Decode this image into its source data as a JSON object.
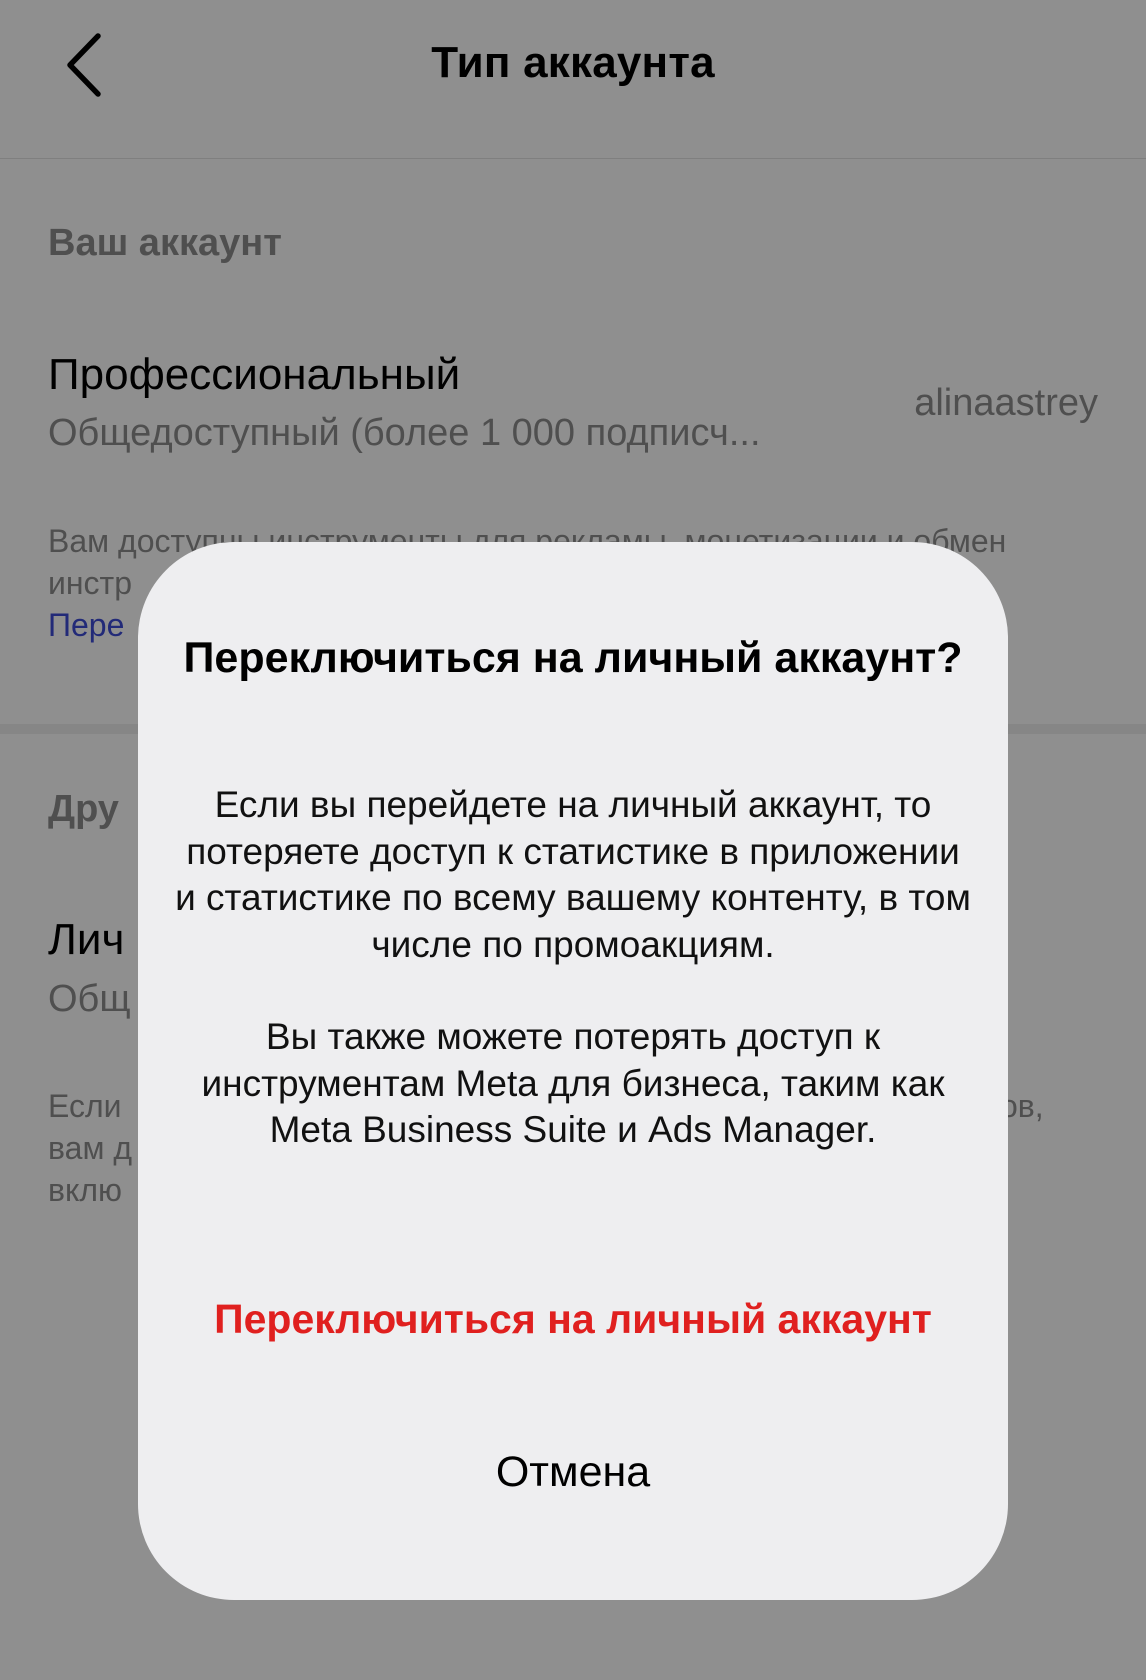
{
  "header": {
    "title": "Тип аккаунта"
  },
  "your_account": {
    "section_title": "Ваш аккаунт",
    "type_title": "Профессиональный",
    "type_subtitle": "Общедоступный (более 1 000 подписч...",
    "username": "alinaastrey",
    "description": "Вам доступны инструменты для рекламы, монетизации и обмен инстр",
    "link_text": "Пере"
  },
  "other_accounts": {
    "section_title": "Дру",
    "type_title": "Лич",
    "type_subtitle": "Общ",
    "description_start": "Если",
    "description_end": "ов,",
    "description_line2": "вам д",
    "description_line3": "вклю"
  },
  "dialog": {
    "title": "Переключиться на личный аккаунт?",
    "body_paragraph_1": "Если вы перейдете на личный аккаунт, то потеряете доступ к статистике в приложении и статистике по всему вашему контенту, в том числе по промоакциям.",
    "body_paragraph_2": "Вы также можете потерять доступ к инструментам Meta для бизнеса, таким как Meta Business Suite и Ads Manager.",
    "confirm_label": "Переключиться на личный аккаунт",
    "cancel_label": "Отмена"
  },
  "colors": {
    "destructive": "#e0201f",
    "link": "#3d4bd6",
    "secondary_text": "#8e8e8e",
    "dialog_background": "#eeeef0"
  }
}
